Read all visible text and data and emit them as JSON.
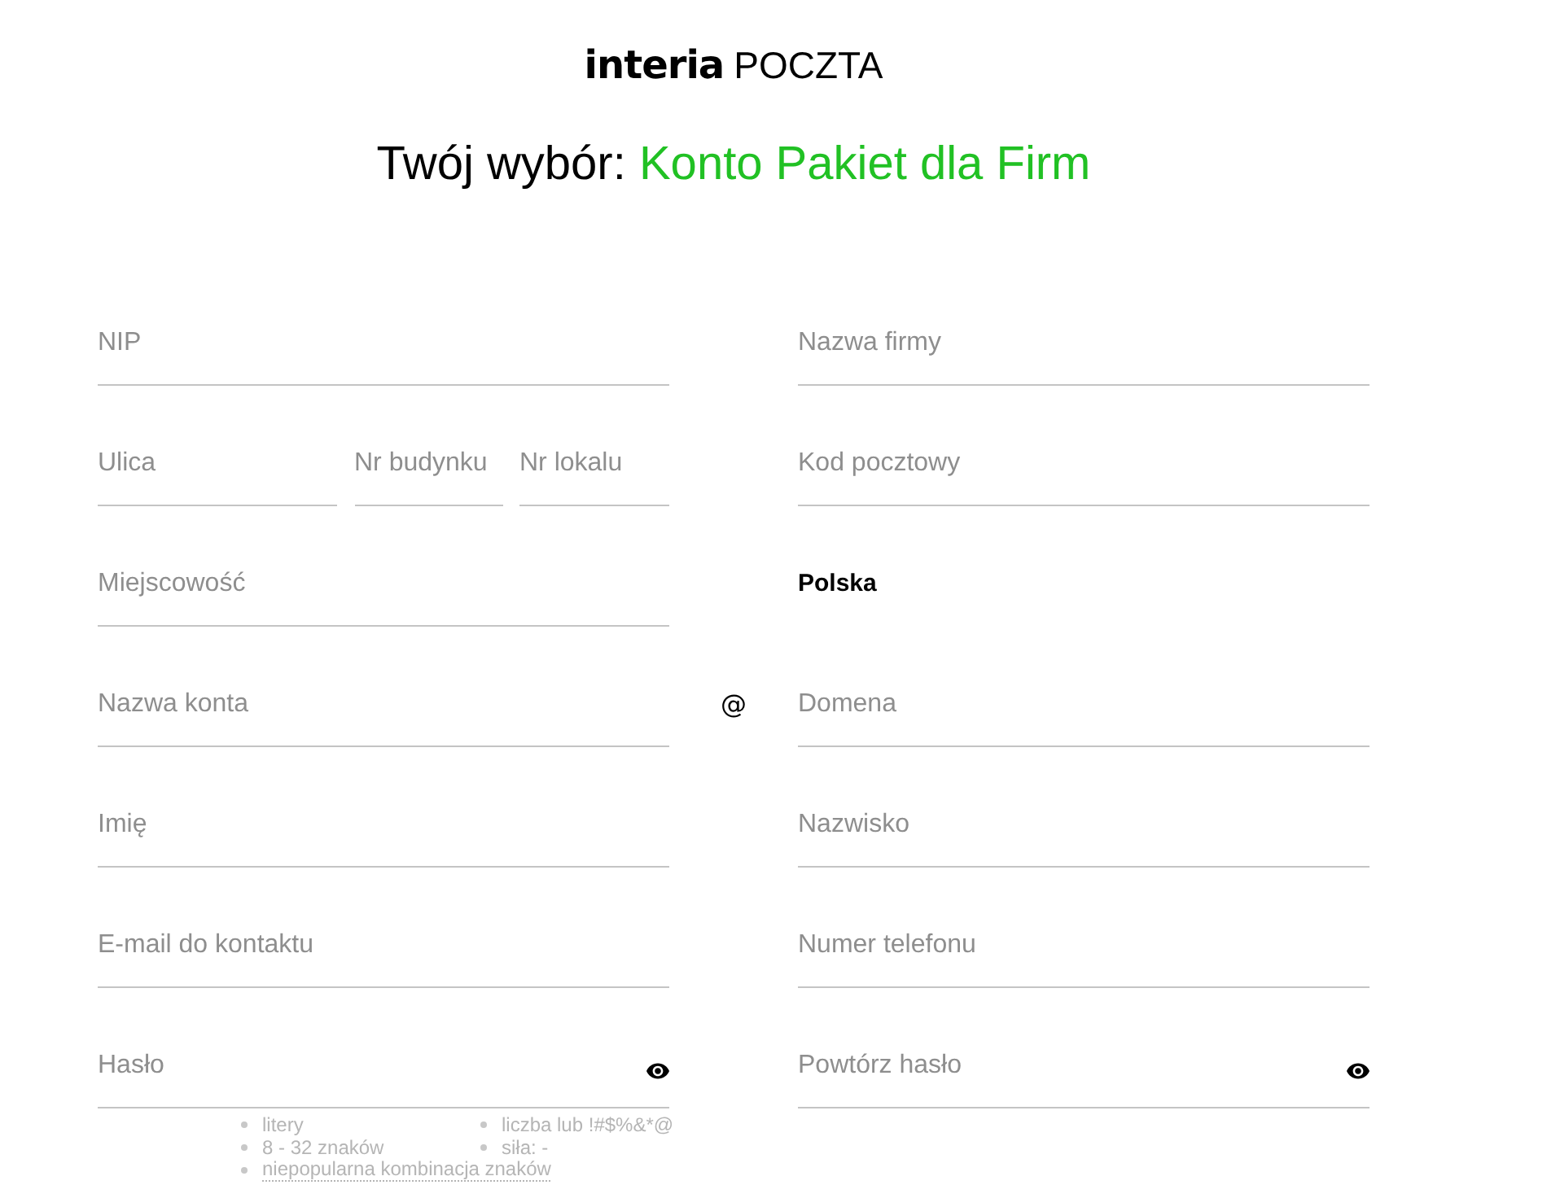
{
  "logo": {
    "brand": "interia",
    "product": "POCZTA"
  },
  "heading": {
    "text": "Twój wybór:",
    "highlight": "Konto Pakiet dla Firm"
  },
  "form": {
    "rows": [
      {
        "left": [
          {
            "kind": "text",
            "placeholder": "NIP"
          }
        ],
        "right": [
          {
            "kind": "text",
            "placeholder": "Nazwa firmy"
          }
        ]
      },
      {
        "left": [
          {
            "kind": "text",
            "placeholder": "Ulica"
          },
          {
            "kind": "text",
            "placeholder": "Nr budynku"
          },
          {
            "kind": "text",
            "placeholder": "Nr lokalu"
          }
        ],
        "right": [
          {
            "kind": "text",
            "placeholder": "Kod pocztowy"
          }
        ]
      },
      {
        "left": [
          {
            "kind": "text",
            "placeholder": "Miejscowość"
          }
        ],
        "right": [
          {
            "kind": "select",
            "value": "Polska"
          }
        ]
      },
      {
        "left": [
          {
            "kind": "text",
            "placeholder": "Nazwa konta"
          }
        ],
        "separator": "@",
        "right": [
          {
            "kind": "text",
            "placeholder": "Domena"
          }
        ]
      },
      {
        "left": [
          {
            "kind": "text",
            "placeholder": "Imię"
          }
        ],
        "right": [
          {
            "kind": "text",
            "placeholder": "Nazwisko"
          }
        ]
      },
      {
        "left": [
          {
            "kind": "text",
            "placeholder": "E-mail do kontaktu"
          }
        ],
        "right": [
          {
            "kind": "text",
            "placeholder": "Numer telefonu"
          }
        ]
      },
      {
        "left": [
          {
            "kind": "password",
            "placeholder": "Hasło",
            "hints": [
              {
                "kind": "rule",
                "text": "litery"
              },
              {
                "kind": "rule",
                "text": "liczba lub !#$%&*@"
              },
              {
                "kind": "rule",
                "text": "8 - 32 znaków"
              },
              {
                "kind": "rule",
                "text": "siła: -"
              },
              {
                "kind": "tooltip",
                "text": "niepopularna kombinacja znaków"
              }
            ]
          }
        ],
        "right": [
          {
            "kind": "password",
            "placeholder": "Powtórz hasło"
          }
        ]
      }
    ]
  }
}
